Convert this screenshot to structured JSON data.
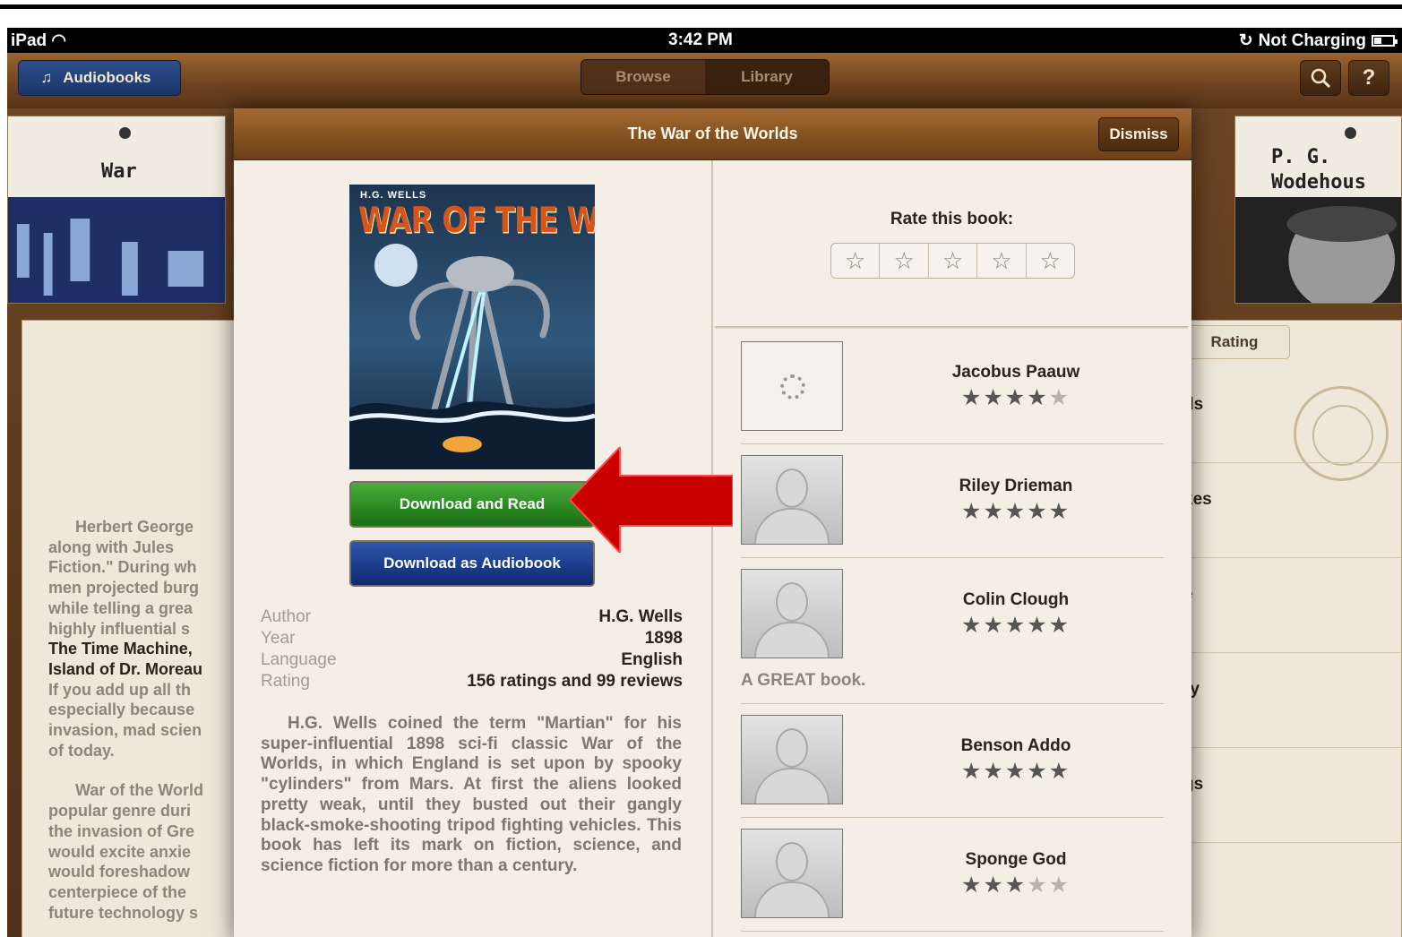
{
  "status_bar": {
    "device": "iPad",
    "time": "3:42 PM",
    "charging": "Not Charging"
  },
  "toolbar": {
    "audiobooks_label": "Audiobooks",
    "tabs": [
      "Browse",
      "Library"
    ],
    "search_icon": "search-icon",
    "help_label": "?"
  },
  "shelf": {
    "left_book_title": "War",
    "right_book_title": "P. G. Wodehous",
    "left_paragraphs": [
      "Herbert George Wells, along with Jules Verne, Fiction.\" During wh men projected burg while telling a grea highly influential s",
      "War of the World popular genre duri the invasion of Gre would excite anxie would foreshadow centerpiece of the future technology s"
    ],
    "left_lines_1": [
      "Herbert George",
      "along with Jules",
      "Fiction.\" During wh",
      "men projected burg",
      "while telling a grea",
      "highly influential s"
    ],
    "left_lines_bold": [
      "The Time Machine,",
      "Island of Dr. Moreau"
    ],
    "left_lines_2": [
      "If you add up all th",
      "especially because",
      "invasion, mad scien",
      "of today."
    ],
    "left_lines_3": [
      "War of the World",
      "popular genre duri",
      "the invasion of Gre",
      "would excite anxie",
      "would foreshadow",
      "centerpiece of the",
      "future technology s"
    ],
    "right_rating_tab": "Rating",
    "right_items": [
      "ds",
      "kes",
      "e",
      "ry",
      "gs"
    ]
  },
  "modal": {
    "title": "The War of the Worlds",
    "dismiss_label": "Dismiss",
    "cover_author": "H.G. WELLS",
    "cover_title": "WAR OF THE WORLDS",
    "download_read_label": "Download and Read",
    "download_audio_label": "Download as Audiobook",
    "info": [
      {
        "key": "Author",
        "value": "H.G. Wells"
      },
      {
        "key": "Year",
        "value": "1898"
      },
      {
        "key": "Language",
        "value": "English"
      },
      {
        "key": "Rating",
        "value": "156 ratings and 99 reviews"
      }
    ],
    "description": "H.G. Wells coined the term \"Martian\" for his super-influential 1898 sci-fi classic War of the Worlds, in which England is set upon by spooky \"cylinders\" from Mars. At first the aliens looked pretty weak, until they busted out their gangly black-smoke-shooting tripod fighting vehicles. This book has left its mark on fiction, science, and science fiction for more than a century.",
    "rate_label": "Rate this book:",
    "rate_stars": 5,
    "reviews": [
      {
        "name": "Jacobus Paauw",
        "stars": 4,
        "text": "",
        "loading": true
      },
      {
        "name": "Riley Drieman",
        "stars": 5,
        "text": "",
        "loading": false
      },
      {
        "name": "Colin Clough",
        "stars": 5,
        "text": "A GREAT book.",
        "loading": false
      },
      {
        "name": "Benson Addo",
        "stars": 5,
        "text": "",
        "loading": false
      },
      {
        "name": "Sponge God",
        "stars": 3,
        "text": "",
        "loading": false
      }
    ]
  },
  "colors": {
    "arrow": "#c80000",
    "read_button": "#2b8a23",
    "audio_button": "#1b3d8c",
    "wood": "#84511f"
  }
}
